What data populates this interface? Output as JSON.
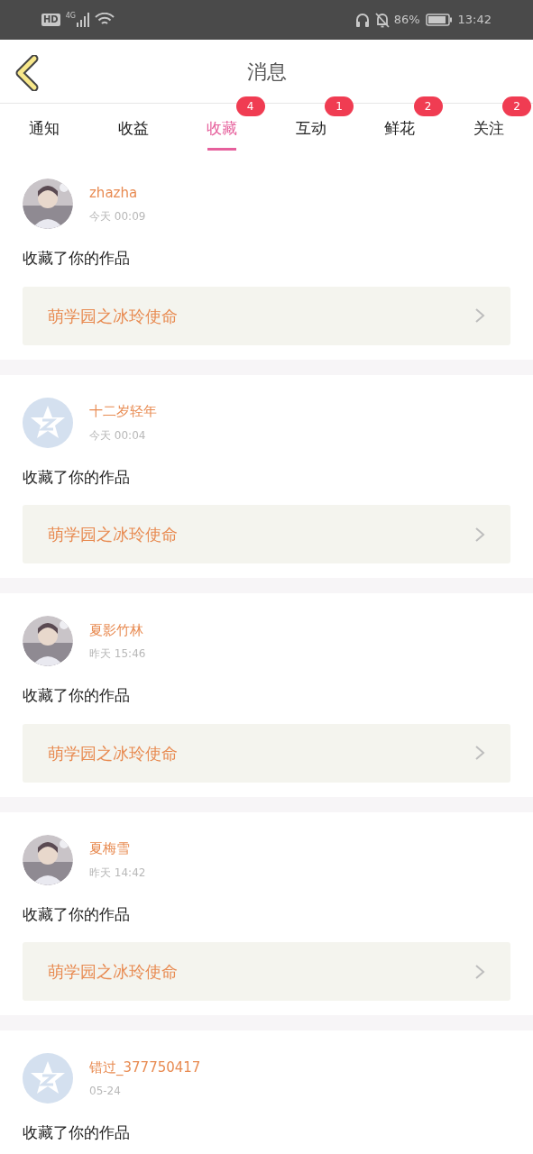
{
  "status_bar": {
    "hd": "HD",
    "network": "4G",
    "battery": "86%",
    "time": "13:42"
  },
  "header": {
    "title": "消息"
  },
  "tabs": [
    {
      "label": "通知",
      "selected": false
    },
    {
      "label": "收益",
      "selected": false
    },
    {
      "label": "收藏",
      "selected": true,
      "badge": "4"
    },
    {
      "label": "互动",
      "selected": false,
      "badge": "1"
    },
    {
      "label": "鲜花",
      "selected": false,
      "badge": "2"
    },
    {
      "label": "关注",
      "selected": false,
      "badge": "2"
    }
  ],
  "messages": [
    {
      "user": "zhazha",
      "time": "今天 00:09",
      "text": "收藏了你的作品",
      "work": "萌学园之冰玲使命"
    },
    {
      "avatar": {
        "kind": "default"
      },
      "user": "十二岁轻年",
      "time": "今天 00:04",
      "text": "收藏了你的作品",
      "work": "萌学园之冰玲使命"
    },
    {
      "user": "夏影竹林",
      "time": "昨天 15:46",
      "text": "收藏了你的作品",
      "work": "萌学园之冰玲使命"
    },
    {
      "user": "夏梅雪",
      "time": "昨天 14:42",
      "text": "收藏了你的作品",
      "work": "萌学园之冰玲使命"
    },
    {
      "avatar": {
        "kind": "default"
      },
      "user": "错过_377750417",
      "time": "05-24",
      "text": "收藏了你的作品"
    }
  ]
}
